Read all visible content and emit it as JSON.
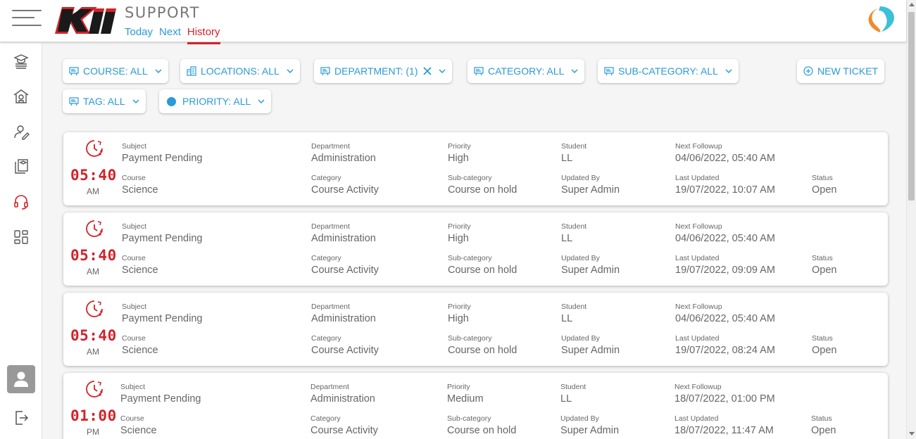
{
  "header": {
    "title": "SUPPORT",
    "tabs": [
      {
        "label": "Today"
      },
      {
        "label": "Next"
      },
      {
        "label": "History"
      }
    ],
    "active_tab": "History",
    "logo_text": "Kii"
  },
  "sidebar": {
    "items": [
      {
        "icon": "graduation-stack-icon"
      },
      {
        "icon": "school-building-icon"
      },
      {
        "icon": "user-edit-icon"
      },
      {
        "icon": "books-icon"
      },
      {
        "icon": "headset-icon"
      },
      {
        "icon": "dashboard-grid-icon"
      }
    ],
    "active_item": "headset-icon"
  },
  "filters": {
    "course": "COURSE: ALL",
    "locations": "LOCATIONS: ALL",
    "department": "DEPARTMENT: (1)",
    "category": "CATEGORY: ALL",
    "subcategory": "SUB-CATEGORY: ALL",
    "tag": "TAG: ALL",
    "priority": "PRIORITY: ALL",
    "new_ticket": "NEW TICKET"
  },
  "labels": {
    "subject": "Subject",
    "course": "Course",
    "department": "Department",
    "category": "Category",
    "priority": "Priority",
    "subcategory": "Sub-category",
    "student": "Student",
    "updated_by": "Updated By",
    "next_followup": "Next Followup",
    "last_updated": "Last Updated",
    "status": "Status"
  },
  "tickets": [
    {
      "time": "05:40",
      "ampm": "AM",
      "subject": "Payment Pending",
      "course": "Science",
      "department": "Administration",
      "category": "Course Activity",
      "priority": "High",
      "subcategory": "Course on hold",
      "student": "LL",
      "updated_by": "Super Admin",
      "next_followup": "04/06/2022, 05:40 AM",
      "last_updated": "19/07/2022, 10:07 AM",
      "status": "Open"
    },
    {
      "time": "05:40",
      "ampm": "AM",
      "subject": "Payment Pending",
      "course": "Science",
      "department": "Administration",
      "category": "Course Activity",
      "priority": "High",
      "subcategory": "Course on hold",
      "student": "LL",
      "updated_by": "Super Admin",
      "next_followup": "04/06/2022, 05:40 AM",
      "last_updated": "19/07/2022, 09:09 AM",
      "status": "Open"
    },
    {
      "time": "05:40",
      "ampm": "AM",
      "subject": "Payment Pending",
      "course": "Science",
      "department": "Administration",
      "category": "Course Activity",
      "priority": "High",
      "subcategory": "Course on hold",
      "student": "LL",
      "updated_by": "Super Admin",
      "next_followup": "04/06/2022, 05:40 AM",
      "last_updated": "19/07/2022, 08:24 AM",
      "status": "Open"
    },
    {
      "time": "01:00",
      "ampm": "PM",
      "subject": "Payment Pending",
      "course": "Science",
      "department": "Administration",
      "category": "Course Activity",
      "priority": "Medium",
      "subcategory": "Course on hold",
      "student": "LL",
      "updated_by": "Super Admin",
      "next_followup": "18/07/2022, 01:00 PM",
      "last_updated": "18/07/2022, 11:47 AM",
      "status": "Open"
    }
  ],
  "colors": {
    "accent_red": "#d2232a",
    "link_blue": "#2a9ad8",
    "brand_orange": "#f28a30",
    "brand_teal": "#3cc0d8"
  }
}
